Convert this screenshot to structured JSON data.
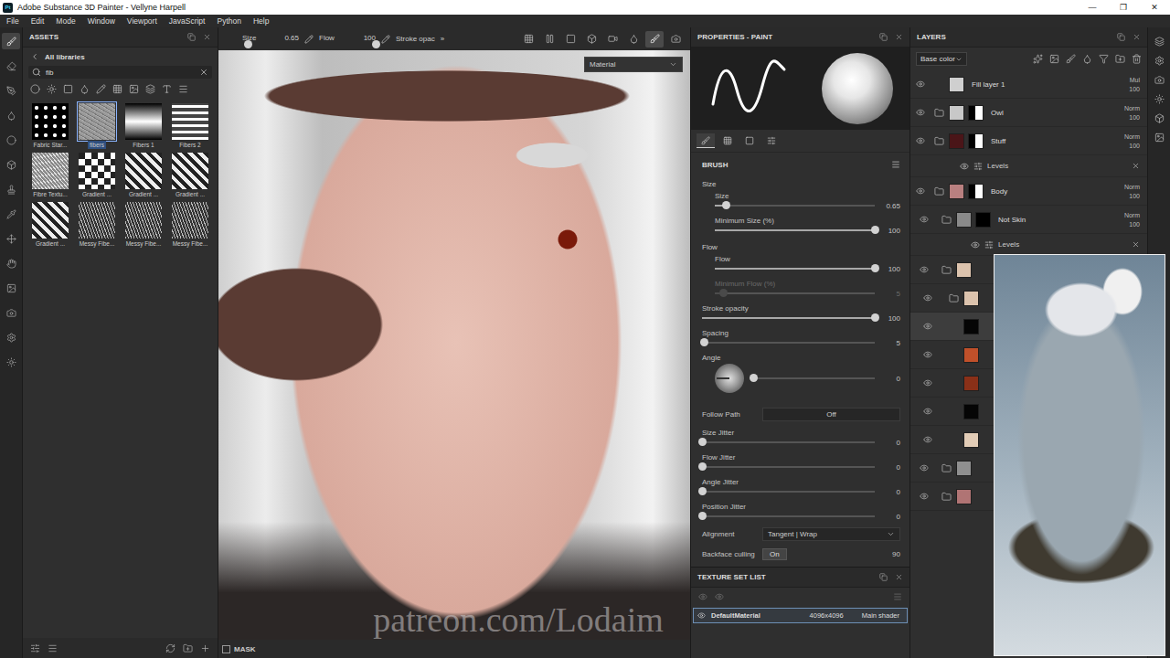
{
  "window": {
    "logo": "Pt",
    "title": "Adobe Substance 3D Painter - Vellyne Harpell",
    "controls": [
      "—",
      "❐",
      "✕"
    ]
  },
  "menu": [
    "File",
    "Edit",
    "Mode",
    "Window",
    "Viewport",
    "JavaScript",
    "Python",
    "Help"
  ],
  "tools": [
    {
      "selected": true
    },
    {
      "selected": false
    },
    {
      "selected": false
    },
    {
      "selected": false
    },
    {
      "selected": false
    },
    {
      "selected": false
    },
    {
      "selected": false
    },
    {
      "selected": false
    },
    {
      "selected": false
    },
    {
      "selected": false
    },
    {
      "selected": false
    },
    {
      "selected": false
    },
    {
      "selected": false
    },
    {
      "selected": false
    }
  ],
  "assets": {
    "title": "ASSETS",
    "library": "All libraries",
    "search": "fib",
    "items": [
      {
        "label": "Fabric Star...",
        "kind": "stars",
        "selected": false
      },
      {
        "label": "fibers",
        "kind": "noise",
        "selected": true
      },
      {
        "label": "Fibers 1",
        "kind": "gradient",
        "selected": false
      },
      {
        "label": "Fibers 2",
        "kind": "stripes",
        "selected": false
      },
      {
        "label": "Fibre Textu...",
        "kind": "fibre",
        "selected": false
      },
      {
        "label": "Gradient ...",
        "kind": "checker",
        "selected": false
      },
      {
        "label": "Gradient ...",
        "kind": "chevron",
        "selected": false
      },
      {
        "label": "Gradient ...",
        "kind": "chevron",
        "selected": false
      },
      {
        "label": "Gradient ...",
        "kind": "chevron",
        "selected": false
      },
      {
        "label": "Messy Fibe...",
        "kind": "messy",
        "selected": false
      },
      {
        "label": "Messy Fibe...",
        "kind": "messy",
        "selected": false
      },
      {
        "label": "Messy Fibe...",
        "kind": "messy",
        "selected": false
      }
    ]
  },
  "viewport": {
    "toolbar": {
      "size_label": "Size",
      "size_value": "0.65",
      "size_level": 0.1,
      "flow_label": "Flow",
      "flow_value": "100",
      "flow_level": 1,
      "stroke_label": "Stroke opac",
      "more": "»",
      "icons": [
        {
          "selected": false
        },
        {
          "selected": false
        },
        {
          "selected": false
        },
        {
          "selected": false
        },
        {
          "selected": false
        },
        {
          "selected": false
        },
        {
          "selected": true
        },
        {
          "selected": false
        }
      ]
    },
    "mode": "Material",
    "watermark": "patreon.com/Lodaim",
    "mask_label": "MASK",
    "mask_checked": false
  },
  "properties": {
    "title": "PROPERTIES - PAINT",
    "tabs": [
      {
        "selected": true
      },
      {
        "selected": false
      },
      {
        "selected": false
      },
      {
        "selected": false
      }
    ],
    "section": "BRUSH",
    "rows": [
      {
        "kind": "group",
        "label": "Size"
      },
      {
        "kind": "slider",
        "label": "Size",
        "value": "0.65",
        "level": 0.07,
        "disabled": false
      },
      {
        "kind": "slider",
        "label": "Minimum Size (%)",
        "value": "100",
        "level": 1,
        "disabled": false
      },
      {
        "kind": "group",
        "label": "Flow"
      },
      {
        "kind": "slider",
        "label": "Flow",
        "value": "100",
        "level": 1,
        "disabled": false
      },
      {
        "kind": "slider",
        "label": "Minimum Flow (%)",
        "value": "5",
        "level": 0.05,
        "disabled": true
      },
      {
        "kind": "slider",
        "label": "Stroke opacity",
        "value": "100",
        "level": 1,
        "disabled": false
      },
      {
        "kind": "slider",
        "label": "Spacing",
        "value": "5",
        "level": 0.01,
        "disabled": false
      },
      {
        "kind": "dial",
        "label": "Angle",
        "value": "0",
        "level": 0
      },
      {
        "kind": "choice",
        "label": "Follow Path",
        "value": "Off"
      },
      {
        "kind": "slider",
        "label": "Size Jitter",
        "value": "0",
        "level": 0,
        "disabled": false
      },
      {
        "kind": "slider",
        "label": "Flow Jitter",
        "value": "0",
        "level": 0,
        "disabled": false
      },
      {
        "kind": "slider",
        "label": "Angle Jitter",
        "value": "0",
        "level": 0,
        "disabled": false
      },
      {
        "kind": "slider",
        "label": "Position Jitter",
        "value": "0",
        "level": 0,
        "disabled": false
      },
      {
        "kind": "select",
        "label": "Alignment",
        "value": "Tangent | Wrap"
      },
      {
        "kind": "toggle",
        "label": "Backface culling",
        "value": "On",
        "extra": "90"
      }
    ]
  },
  "texture_sets": {
    "title": "TEXTURE SET LIST",
    "items": [
      {
        "name": "DefaultMaterial",
        "resolution": "4096x4096",
        "shader": "Main shader",
        "selected": true,
        "visible": true
      }
    ]
  },
  "layers": {
    "title": "LAYERS",
    "channel": "Base color",
    "items": [
      {
        "kind": "layer",
        "name": "Fill layer 1",
        "blend": "Mul",
        "opacity": "100",
        "color": "#cfcfcf",
        "mask": "none",
        "folder": false,
        "visible": true,
        "selected": false,
        "depth": 0
      },
      {
        "kind": "layer",
        "name": "Owl",
        "blend": "Norm",
        "opacity": "100",
        "color": "#c8c8c8",
        "mask": "mixed",
        "folder": true,
        "visible": true,
        "selected": false,
        "depth": 0
      },
      {
        "kind": "layer",
        "name": "Stuff",
        "blend": "Norm",
        "opacity": "100",
        "color": "#4a1518",
        "mask": "mixed",
        "folder": true,
        "visible": true,
        "selected": false,
        "depth": 0
      },
      {
        "kind": "effect",
        "name": "Levels",
        "visible": true,
        "depth": 0
      },
      {
        "kind": "layer",
        "name": "Body",
        "blend": "Norm",
        "opacity": "100",
        "color": "#b98080",
        "mask": "mixed",
        "folder": true,
        "visible": true,
        "selected": false,
        "depth": 0
      },
      {
        "kind": "layer",
        "name": "Not Skin",
        "blend": "Norm",
        "opacity": "100",
        "color": "#8a8a8a",
        "mask": "black",
        "folder": true,
        "visible": true,
        "selected": false,
        "depth": 1
      },
      {
        "kind": "effect",
        "name": "Levels",
        "visible": true,
        "depth": 1
      },
      {
        "kind": "layer",
        "color": "#dcc3ad",
        "mask": "none",
        "folder": true,
        "visible": true,
        "selected": false,
        "depth": 1
      },
      {
        "kind": "layer",
        "color": "#dcc3ad",
        "mask": "none",
        "folder": true,
        "visible": true,
        "selected": false,
        "depth": 2
      },
      {
        "kind": "layer",
        "color": "#050505",
        "mask": "none",
        "folder": false,
        "visible": true,
        "selected": true,
        "depth": 2
      },
      {
        "kind": "layer",
        "color": "#c0502a",
        "mask": "none",
        "folder": false,
        "visible": true,
        "selected": false,
        "depth": 2
      },
      {
        "kind": "layer",
        "color": "#8a3018",
        "mask": "none",
        "folder": false,
        "visible": true,
        "selected": false,
        "depth": 2
      },
      {
        "kind": "layer",
        "color": "#050505",
        "mask": "none",
        "folder": false,
        "visible": true,
        "selected": false,
        "depth": 2
      },
      {
        "kind": "layer",
        "color": "#e2ccb6",
        "mask": "none",
        "folder": false,
        "visible": true,
        "selected": false,
        "depth": 2
      },
      {
        "kind": "layer",
        "color": "#8f8f8f",
        "mask": "none",
        "folder": true,
        "visible": true,
        "selected": false,
        "depth": 1
      },
      {
        "kind": "layer",
        "color": "#b07474",
        "mask": "none",
        "folder": true,
        "visible": true,
        "selected": false,
        "depth": 1
      }
    ]
  }
}
